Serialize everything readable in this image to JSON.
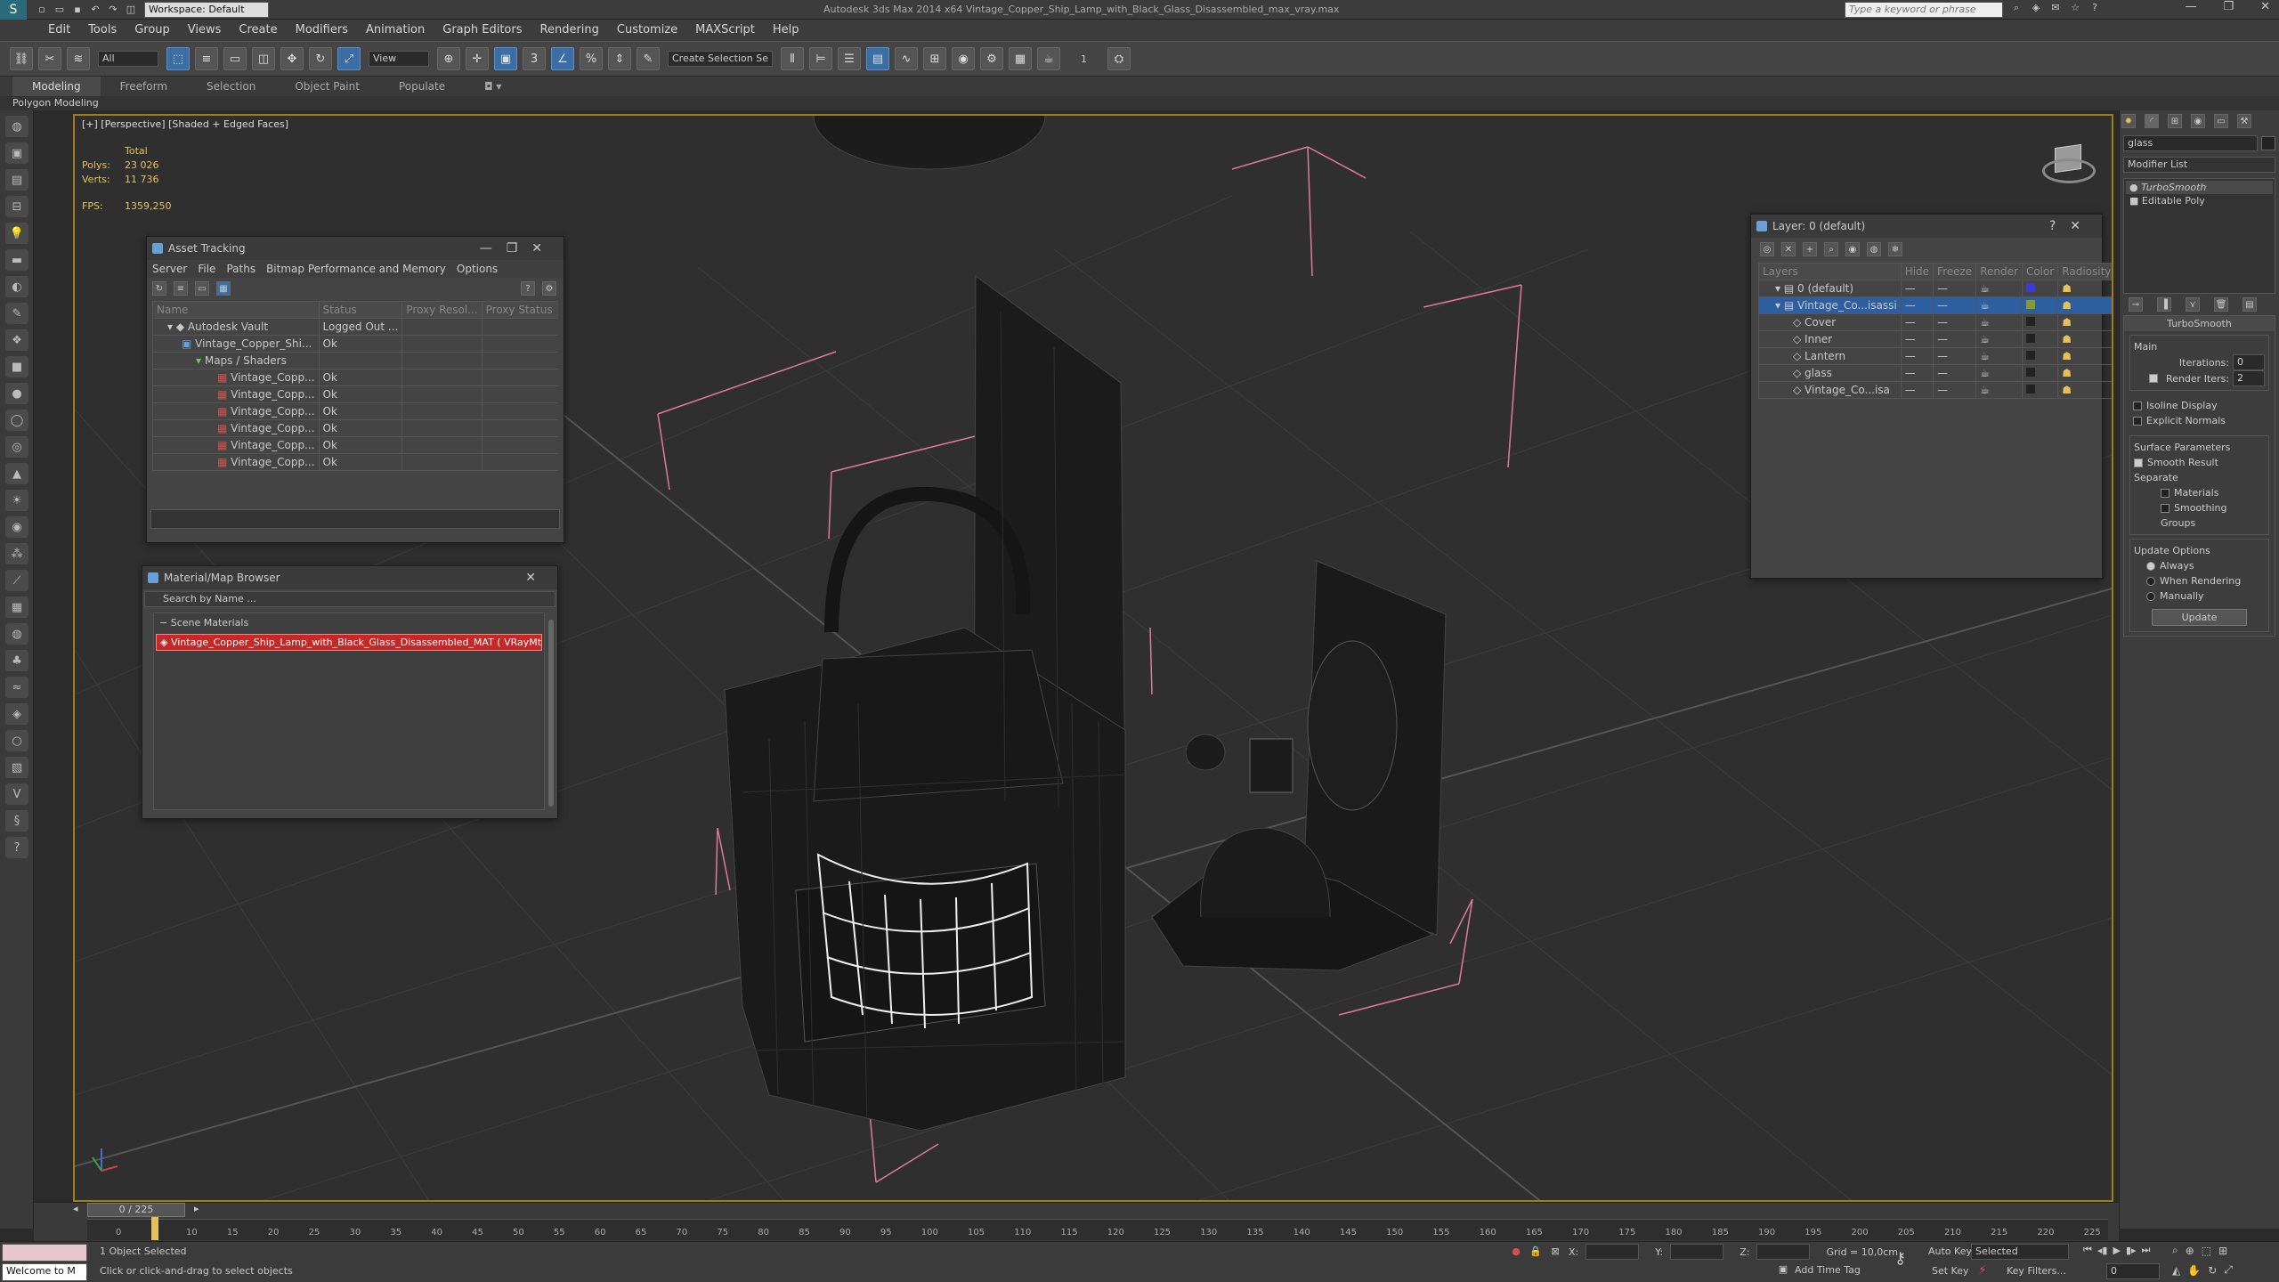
{
  "app": {
    "title": "Autodesk 3ds Max  2014 x64      Vintage_Copper_Ship_Lamp_with_Black_Glass_Disassembled_max_vray.max",
    "workspace": "Workspace: Default",
    "search_placeholder": "Type a keyword or phrase"
  },
  "menu": [
    "Edit",
    "Tools",
    "Group",
    "Views",
    "Create",
    "Modifiers",
    "Animation",
    "Graph Editors",
    "Rendering",
    "Customize",
    "MAXScript",
    "Help"
  ],
  "toolbar": {
    "filter_value": "All",
    "refcoord_value": "View",
    "selection_set_placeholder": "Create Selection Se",
    "spinner_value": "1"
  },
  "ribbon": {
    "tabs": [
      "Modeling",
      "Freeform",
      "Selection",
      "Object Paint",
      "Populate"
    ],
    "sub_label": "Polygon Modeling"
  },
  "viewport": {
    "label": "[+] [Perspective] [Shaded + Edged Faces]",
    "stats_total": "Total",
    "polys_label": "Polys:",
    "polys_value": "23 026",
    "verts_label": "Verts:",
    "verts_value": "11 736",
    "fps_label": "FPS:",
    "fps_value": "1359,250"
  },
  "asset_tracking": {
    "title": "Asset Tracking",
    "menu": [
      "Server",
      "File",
      "Paths",
      "Bitmap Performance and Memory",
      "Options"
    ],
    "columns": [
      "Name",
      "Status",
      "Proxy Resol...",
      "Proxy Status"
    ],
    "rows": [
      {
        "name": "Autodesk Vault",
        "status": "Logged Out ...",
        "indent": 0
      },
      {
        "name": "Vintage_Copper_Shi...",
        "status": "Ok",
        "indent": 1
      },
      {
        "name": "Maps / Shaders",
        "status": "",
        "indent": 2
      },
      {
        "name": "Vintage_Copp...",
        "status": "Ok",
        "indent": 3
      },
      {
        "name": "Vintage_Copp...",
        "status": "Ok",
        "indent": 3
      },
      {
        "name": "Vintage_Copp...",
        "status": "Ok",
        "indent": 3
      },
      {
        "name": "Vintage_Copp...",
        "status": "Ok",
        "indent": 3
      },
      {
        "name": "Vintage_Copp...",
        "status": "Ok",
        "indent": 3
      },
      {
        "name": "Vintage_Copp...",
        "status": "Ok",
        "indent": 3
      }
    ]
  },
  "material_browser": {
    "title": "Material/Map Browser",
    "search_placeholder": "Search by Name ...",
    "group_label": "Scene Materials",
    "selected_item": "Vintage_Copper_Ship_Lamp_with_Black_Glass_Disassembled_MAT ( VRayMtl )"
  },
  "layer_manager": {
    "title": "Layer: 0 (default)",
    "columns": [
      "Layers",
      "Hide",
      "Freeze",
      "Render",
      "Color",
      "Radiosity"
    ],
    "rows": [
      {
        "name": "0 (default)",
        "color": "#3b3bd0",
        "indent": 0
      },
      {
        "name": "Vintage_Co...isassi",
        "color": "#8a9a2a",
        "indent": 0,
        "selected": true
      },
      {
        "name": "Cover",
        "color": "#222222",
        "indent": 1
      },
      {
        "name": "Inner",
        "color": "#222222",
        "indent": 1
      },
      {
        "name": "Lantern",
        "color": "#222222",
        "indent": 1
      },
      {
        "name": "glass",
        "color": "#222222",
        "indent": 1
      },
      {
        "name": "Vintage_Co...isa",
        "color": "#222222",
        "indent": 1
      }
    ]
  },
  "command_panel": {
    "object_name": "glass",
    "modifier_list": "Modifier List",
    "stack": [
      "TurboSmooth",
      "Editable Poly"
    ],
    "rollout_title": "TurboSmooth",
    "main_label": "Main",
    "iterations_label": "Iterations:",
    "iterations_value": "0",
    "render_iters_label": "Render Iters:",
    "render_iters_value": "2",
    "isoline_label": "Isoline Display",
    "explicit_label": "Explicit Normals",
    "surface_label": "Surface Parameters",
    "smooth_result_label": "Smooth Result",
    "separate_label": "Separate",
    "materials_label": "Materials",
    "smoothing_groups_label": "Smoothing Groups",
    "update_options_label": "Update Options",
    "always_label": "Always",
    "when_rendering_label": "When Rendering",
    "manually_label": "Manually",
    "update_button": "Update"
  },
  "timeline": {
    "frame_label": "0 / 225",
    "ticks": [
      "0",
      "5",
      "10",
      "15",
      "20",
      "25",
      "30",
      "35",
      "40",
      "45",
      "50",
      "55",
      "60",
      "65",
      "70",
      "75",
      "80",
      "85",
      "90",
      "95",
      "100",
      "105",
      "110",
      "115",
      "120",
      "125",
      "130",
      "135",
      "140",
      "145",
      "150",
      "155",
      "160",
      "165",
      "170",
      "175",
      "180",
      "185",
      "190",
      "195",
      "200",
      "205",
      "210",
      "215",
      "220",
      "225"
    ]
  },
  "status": {
    "script_listener": "Welcome to M",
    "selected_text": "1 Object Selected",
    "prompt_text": "Click or click-and-drag to select objects",
    "x_label": "X:",
    "y_label": "Y:",
    "z_label": "Z:",
    "grid_text": "Grid = 10,0cm",
    "add_time_tag": "Add Time Tag",
    "auto_key": "Auto Key",
    "selected_dropdown": "Selected",
    "set_key": "Set Key",
    "key_filters": "Key Filters...",
    "frame_value": "0"
  }
}
